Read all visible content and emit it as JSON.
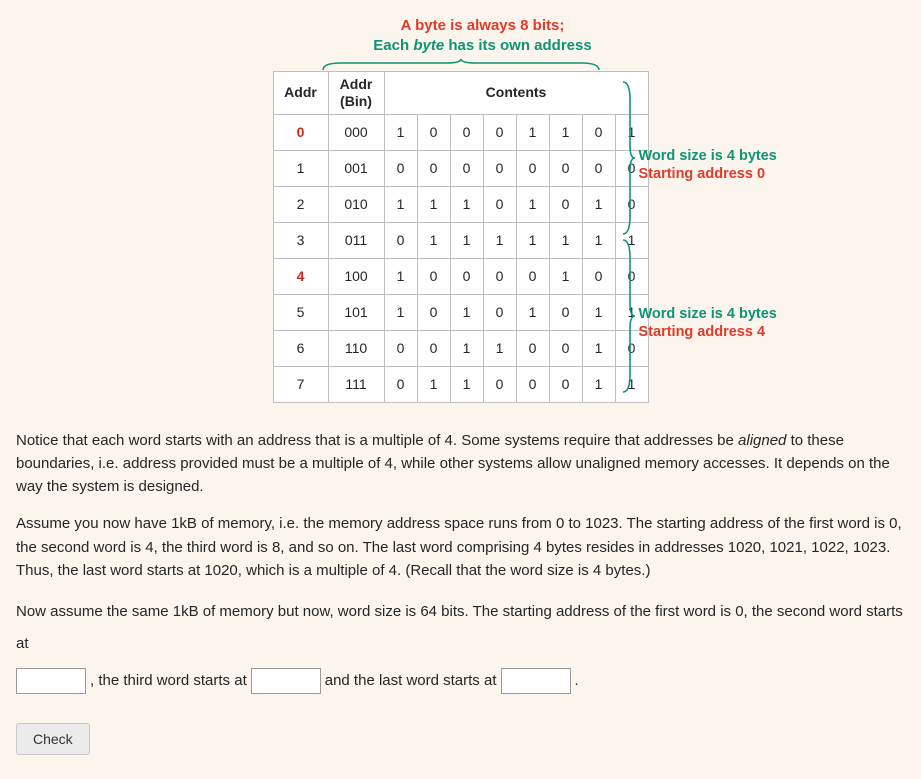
{
  "caption": {
    "line1": "A byte is always 8 bits;",
    "line2_prefix": "Each ",
    "line2_em": "byte",
    "line2_suffix": " has its own address"
  },
  "headers": {
    "addr": "Addr",
    "addr_bin": "Addr (Bin)",
    "contents": "Contents"
  },
  "rows": [
    {
      "dec": "0",
      "bin": "000",
      "bits": [
        "1",
        "0",
        "0",
        "0",
        "1",
        "1",
        "0",
        "1"
      ],
      "hl": true
    },
    {
      "dec": "1",
      "bin": "001",
      "bits": [
        "0",
        "0",
        "0",
        "0",
        "0",
        "0",
        "0",
        "0"
      ],
      "hl": false
    },
    {
      "dec": "2",
      "bin": "010",
      "bits": [
        "1",
        "1",
        "1",
        "0",
        "1",
        "0",
        "1",
        "0"
      ],
      "hl": false
    },
    {
      "dec": "3",
      "bin": "011",
      "bits": [
        "0",
        "1",
        "1",
        "1",
        "1",
        "1",
        "1",
        "1"
      ],
      "hl": false
    },
    {
      "dec": "4",
      "bin": "100",
      "bits": [
        "1",
        "0",
        "0",
        "0",
        "0",
        "1",
        "0",
        "0"
      ],
      "hl": true
    },
    {
      "dec": "5",
      "bin": "101",
      "bits": [
        "1",
        "0",
        "1",
        "0",
        "1",
        "0",
        "1",
        "1"
      ],
      "hl": false
    },
    {
      "dec": "6",
      "bin": "110",
      "bits": [
        "0",
        "0",
        "1",
        "1",
        "0",
        "0",
        "1",
        "0"
      ],
      "hl": false
    },
    {
      "dec": "7",
      "bin": "111",
      "bits": [
        "0",
        "1",
        "1",
        "0",
        "0",
        "0",
        "1",
        "1"
      ],
      "hl": false
    }
  ],
  "annot1": {
    "l1": "Word size is 4 bytes",
    "l2": "Starting address 0"
  },
  "annot2": {
    "l1": "Word size is 4 bytes",
    "l2": "Starting address 4"
  },
  "para1_a": "Notice that each word starts with an address that is a multiple of 4. Some systems require that addresses be ",
  "para1_em": "aligned",
  "para1_b": " to these boundaries, i.e. address provided must be a multiple of 4, while other systems allow unaligned memory accesses. It depends on the way the system is designed.",
  "para2": "Assume you now have 1kB of memory, i.e. the memory address space runs from 0 to 1023. The starting address of the first word is 0, the second word is 4, the third word is 8, and so on. The last word comprising 4 bytes resides in addresses 1020, 1021, 1022, 1023. Thus, the last word starts at 1020, which is a multiple of 4. (Recall that the word size is 4 bytes.)",
  "q": {
    "p1": "Now assume the same 1kB of memory but now, word size is 64 bits. The starting address of the first word is 0, the second word starts at",
    "p2": ", the third word starts at",
    "p3": "and the last word  starts at",
    "p4": "."
  },
  "check_label": "Check"
}
